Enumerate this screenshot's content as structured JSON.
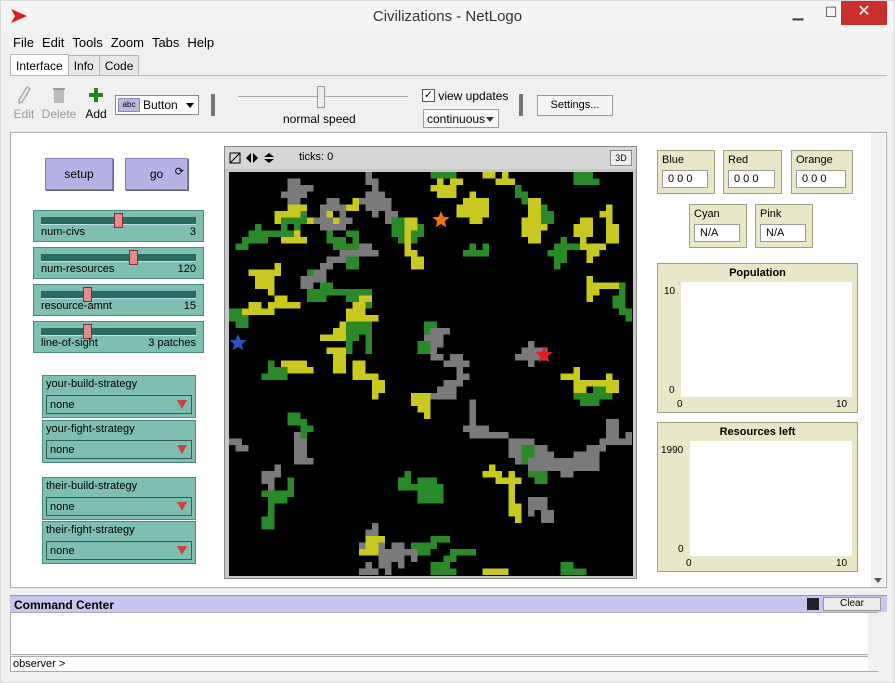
{
  "window": {
    "title": "Civilizations - NetLogo",
    "minimize": "▁",
    "maximize": "☐",
    "close": "✕"
  },
  "menu": [
    "File",
    "Edit",
    "Tools",
    "Zoom",
    "Tabs",
    "Help"
  ],
  "tabs": [
    "Interface",
    "Info",
    "Code"
  ],
  "toolbar": {
    "edit": "Edit",
    "delete": "Delete",
    "add": "Add",
    "widget_type": "Button",
    "speed_label": "normal speed",
    "view_updates": "view updates",
    "update_mode": "continuous",
    "settings": "Settings..."
  },
  "buttons": {
    "setup": "setup",
    "go": "go"
  },
  "sliders": [
    {
      "label": "num-civs",
      "value": "3",
      "level": 0.5
    },
    {
      "label": "num-resources",
      "value": "120",
      "level": 0.6
    },
    {
      "label": "resource-amnt",
      "value": "15",
      "level": 0.29
    },
    {
      "label": "line-of-sight",
      "value": "3 patches",
      "level": 0.29
    }
  ],
  "choosers": [
    {
      "label": "your-build-strategy",
      "value": "none"
    },
    {
      "label": "your-fight-strategy",
      "value": "none"
    },
    {
      "label": "their-build-strategy",
      "value": "none"
    },
    {
      "label": "their-fight-strategy",
      "value": "none"
    }
  ],
  "view": {
    "ticks": "ticks: 0",
    "three_d": "3D"
  },
  "monitors": [
    {
      "label": "Blue",
      "value": "0 0 0"
    },
    {
      "label": "Red",
      "value": "0 0 0"
    },
    {
      "label": "Orange",
      "value": "0 0 0"
    },
    {
      "label": "Cyan",
      "value": "N/A"
    },
    {
      "label": "Pink",
      "value": "N/A"
    }
  ],
  "plots": [
    {
      "title": "Population",
      "ymax": "10",
      "ymin": "0",
      "xmin": "0",
      "xmax": "10"
    },
    {
      "title": "Resources left",
      "ymax": "1990",
      "ymin": "0",
      "xmin": "0",
      "xmax": "10"
    }
  ],
  "command_center": {
    "title": "Command Center",
    "clear": "Clear",
    "prompt": "observer >"
  },
  "colors": {
    "yellow": "#c8c820",
    "green": "#2a8a2a",
    "gray": "#7a7a7a",
    "orange_star": "#f07020",
    "red_star": "#e02020",
    "blue_star": "#2a52c0"
  }
}
